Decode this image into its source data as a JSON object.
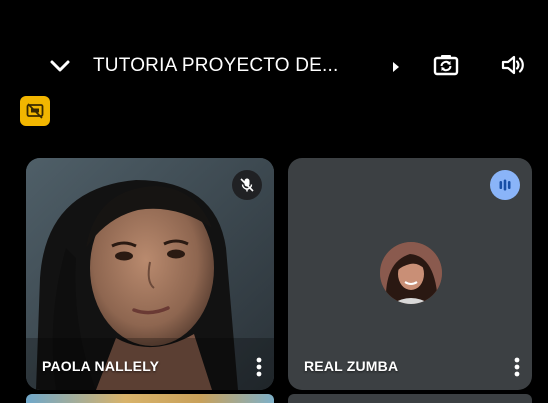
{
  "header": {
    "meeting_title": "TUTORIA  PROYECTO DE... ",
    "icons": {
      "collapse": "chevron-down-icon",
      "title_more": "triangle-right-icon",
      "switch_camera": "switch-camera-icon",
      "speaker": "speaker-icon",
      "presenting": "cast-icon"
    }
  },
  "participants": [
    {
      "name": "PAOLA NALLELY",
      "state": "muted",
      "video": "camera-on",
      "status_icon": "mic-off-icon",
      "menu_icon": "more-vertical-icon"
    },
    {
      "name": "REAL ZUMBA",
      "state": "speaking",
      "video": "camera-off-avatar",
      "status_icon": "audio-level-icon",
      "menu_icon": "more-vertical-icon"
    }
  ],
  "colors": {
    "background": "#000000",
    "tile_dark": "#3c4043",
    "presenting_badge": "#f2b600",
    "speaking_badge": "#8ab4f8",
    "mute_badge": "#202124",
    "text": "#ffffff"
  }
}
